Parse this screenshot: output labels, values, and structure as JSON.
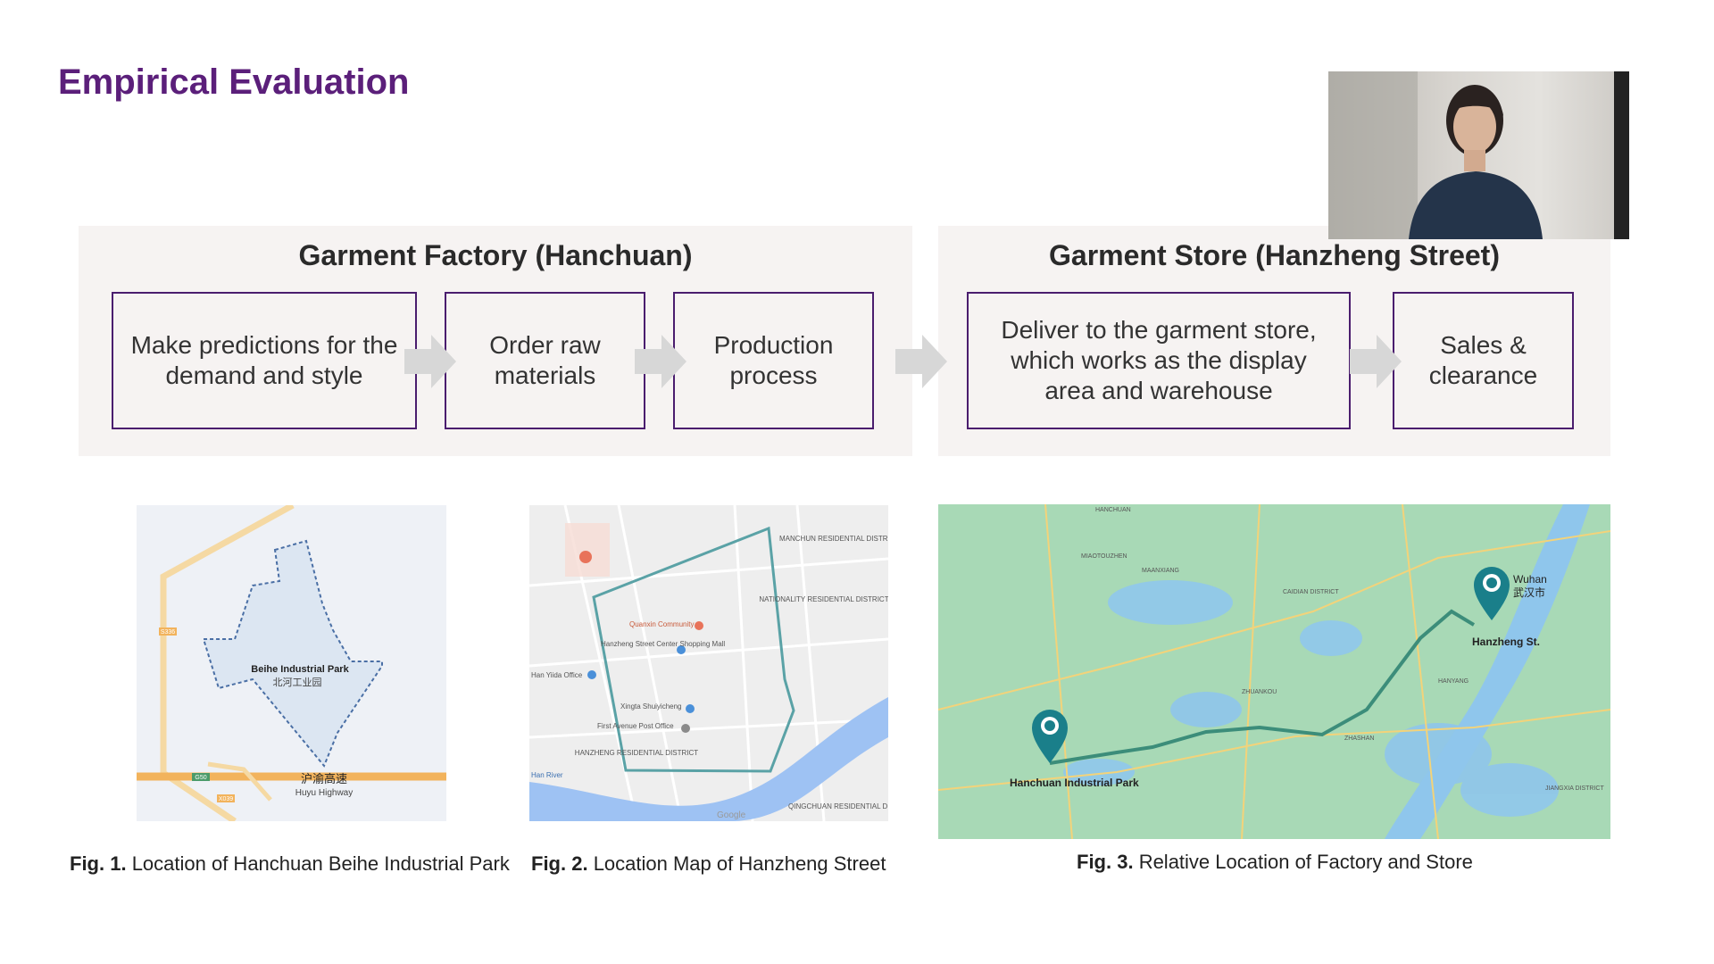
{
  "slide": {
    "title": "Empirical Evaluation",
    "factory": {
      "title": "Garment Factory (Hanchuan)",
      "steps": [
        {
          "lines": [
            "Make predictions for the",
            "demand and style"
          ]
        },
        {
          "lines": [
            "Order raw",
            "materials"
          ]
        },
        {
          "lines": [
            "Production",
            "process"
          ]
        }
      ]
    },
    "store": {
      "title": "Garment Store (Hanzheng Street)",
      "steps": [
        {
          "lines": [
            "Deliver to the garment store,",
            "which works as the display",
            "area and warehouse"
          ]
        },
        {
          "lines": [
            "Sales &",
            "clearance"
          ]
        }
      ]
    },
    "figures": [
      {
        "label": "Fig. 1.",
        "caption": "Location of Hanchuan Beihe Industrial Park"
      },
      {
        "label": "Fig. 2.",
        "caption": "Location Map of Hanzheng Street"
      },
      {
        "label": "Fig. 3.",
        "caption": "Relative Location of Factory and Store"
      }
    ],
    "map1": {
      "park_name_en": "Beihe Industrial Park",
      "park_name_cn": "北河工业园",
      "highway_cn": "沪渝高速",
      "highway_en": "Huyu Highway",
      "road_badges": [
        "S336",
        "G50",
        "X039"
      ]
    },
    "map2": {
      "labels": [
        "MANCHUN RESIDENTIAL DISTRICT",
        "NATIONALITY RESIDENTIAL DISTRICT",
        "Quanxin Community",
        "Hanzheng Street Center Shopping Mall",
        "Xingta Shuiyicheng",
        "First Avenue Post Office",
        "Han Yiida Office",
        "HANZHENG RESIDENTIAL DISTRICT",
        "Han River",
        "Google",
        "QINGCHUAN RESIDENTIAL DISTRICT"
      ]
    },
    "map3": {
      "factory_label": "Hanchuan Industrial Park",
      "store_label": "Hanzheng St.",
      "city_en": "Wuhan",
      "city_cn": "武汉市",
      "other_labels": [
        "HANCHUAN",
        "MIAOTOUZHEN",
        "MAANXIANG",
        "CAIDIAN DISTRICT",
        "ZHUANKOU",
        "ZHASHAN",
        "HANYANG",
        "JIANGXIA DISTRICT"
      ]
    },
    "colors": {
      "title": "#5b1f7a",
      "box_border": "#4a1d6e",
      "panel_bg": "#f6f3f2",
      "arrow": "#d7d7d7",
      "route": "#3c8d7a",
      "pin": "#1a7f8a"
    }
  }
}
